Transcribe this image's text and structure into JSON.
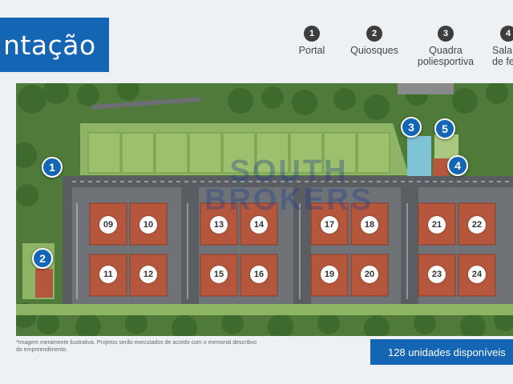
{
  "title": "ntação",
  "legend": [
    {
      "num": "1",
      "label": "Portal"
    },
    {
      "num": "2",
      "label": "Quiosques"
    },
    {
      "num": "3",
      "label": "Quadra poliesportiva"
    },
    {
      "num": "4",
      "label": "Sala de fe"
    }
  ],
  "pins": [
    "1",
    "2",
    "3",
    "4",
    "5"
  ],
  "blocks": [
    "09",
    "10",
    "13",
    "14",
    "17",
    "18",
    "21",
    "22",
    "11",
    "12",
    "15",
    "16",
    "19",
    "20",
    "23",
    "24"
  ],
  "watermark": {
    "line1": "SOUTH",
    "line2": "BROKERS"
  },
  "note": "*Imagem meramente ilustrativa. Projetos serão executados de acordo com o memorial descritivo do empreendimento.",
  "units_text": "128 unidades disponíveis",
  "colors": {
    "brand_blue": "#1565b5",
    "roof": "#b5573d",
    "grass": "#7ba05b",
    "road": "#5a5d62"
  }
}
